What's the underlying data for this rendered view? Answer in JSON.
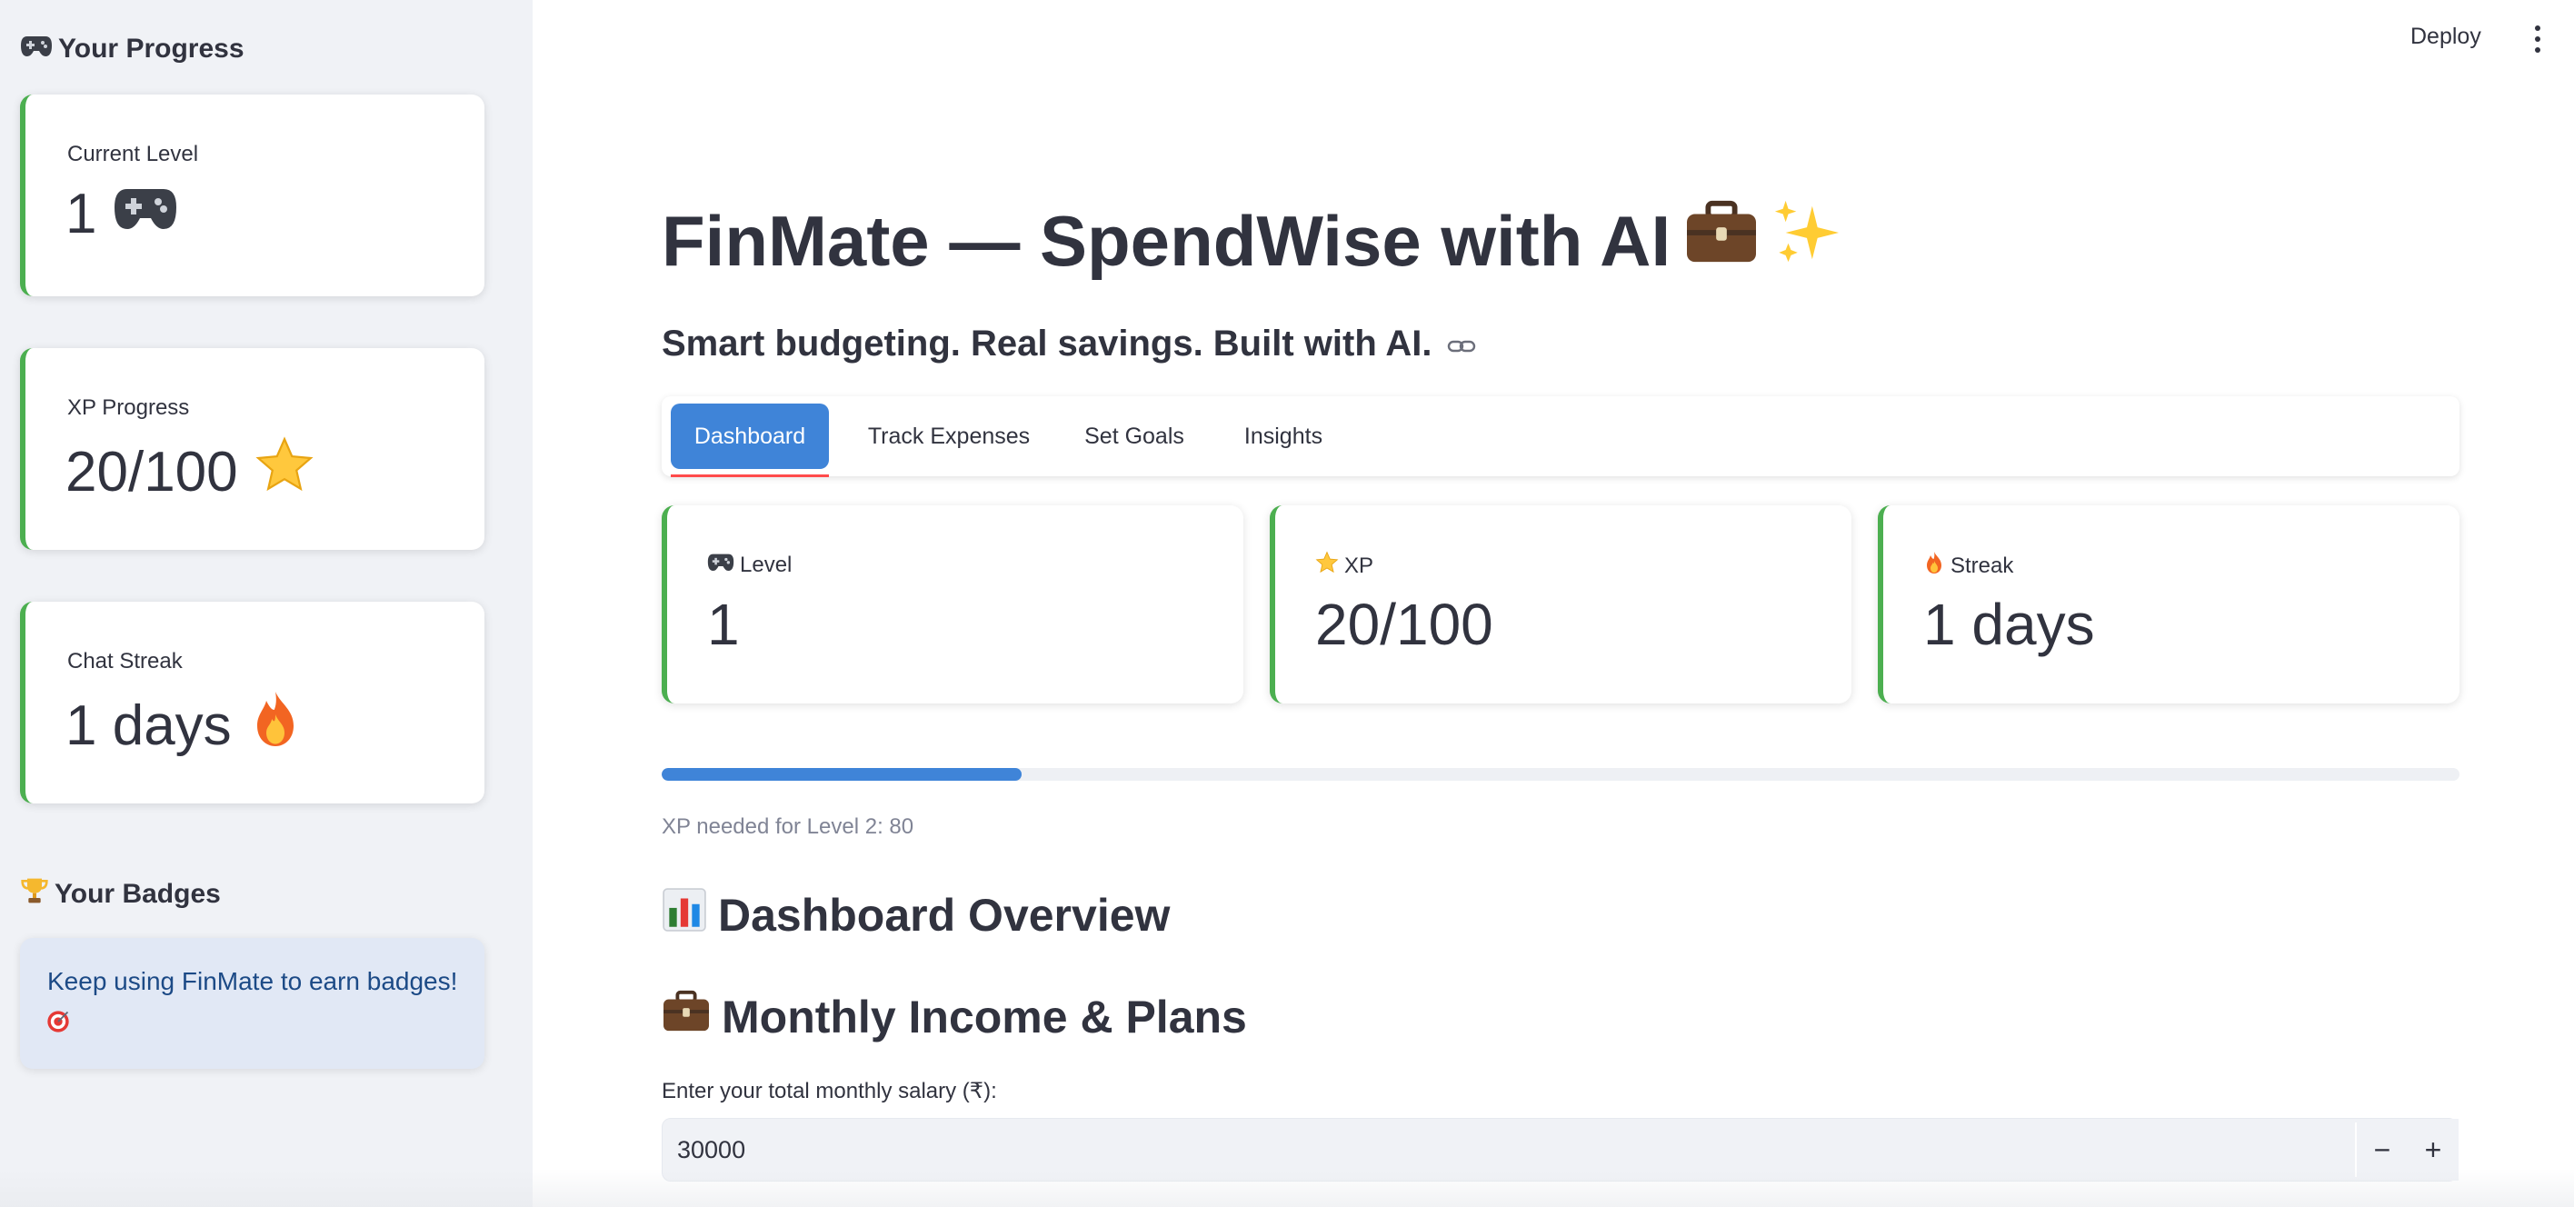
{
  "header": {
    "deploy_label": "Deploy",
    "menu_icon": "more-vertical-icon"
  },
  "sidebar": {
    "progress_heading": "Your Progress",
    "cards": [
      {
        "label": "Current Level",
        "value": "1"
      },
      {
        "label": "XP Progress",
        "value": "20/100"
      },
      {
        "label": "Chat Streak",
        "value": "1 days"
      }
    ],
    "badges_heading": "Your Badges",
    "badges_message": "Keep using FinMate to earn badges!"
  },
  "main": {
    "title": "FinMate — SpendWise with AI",
    "subtitle": "Smart budgeting. Real savings. Built with AI.",
    "tabs": [
      {
        "label": "Dashboard",
        "active": true
      },
      {
        "label": "Track Expenses",
        "active": false
      },
      {
        "label": "Set Goals",
        "active": false
      },
      {
        "label": "Insights",
        "active": false
      }
    ],
    "metrics": [
      {
        "label": "Level",
        "value": "1",
        "icon": "game-controller-icon"
      },
      {
        "label": "XP",
        "value": "20/100",
        "icon": "star-icon"
      },
      {
        "label": "Streak",
        "value": "1 days",
        "icon": "fire-icon"
      }
    ],
    "xp_progress": 0.2,
    "xp_note": "XP needed for Level 2: 80",
    "section_dashboard": "Dashboard Overview",
    "section_income": "Monthly Income & Plans",
    "salary_label": "Enter your total monthly salary (₹):",
    "salary_value": "30000",
    "decrement_label": "−",
    "increment_label": "+"
  },
  "colors": {
    "accent": "#3f84d8",
    "card_border": "#4caf50",
    "sidebar_bg": "#f0f2f6",
    "tab_underline": "#ff4b4b",
    "info_bg": "#e1e8f5",
    "info_text": "#1c4a86"
  }
}
